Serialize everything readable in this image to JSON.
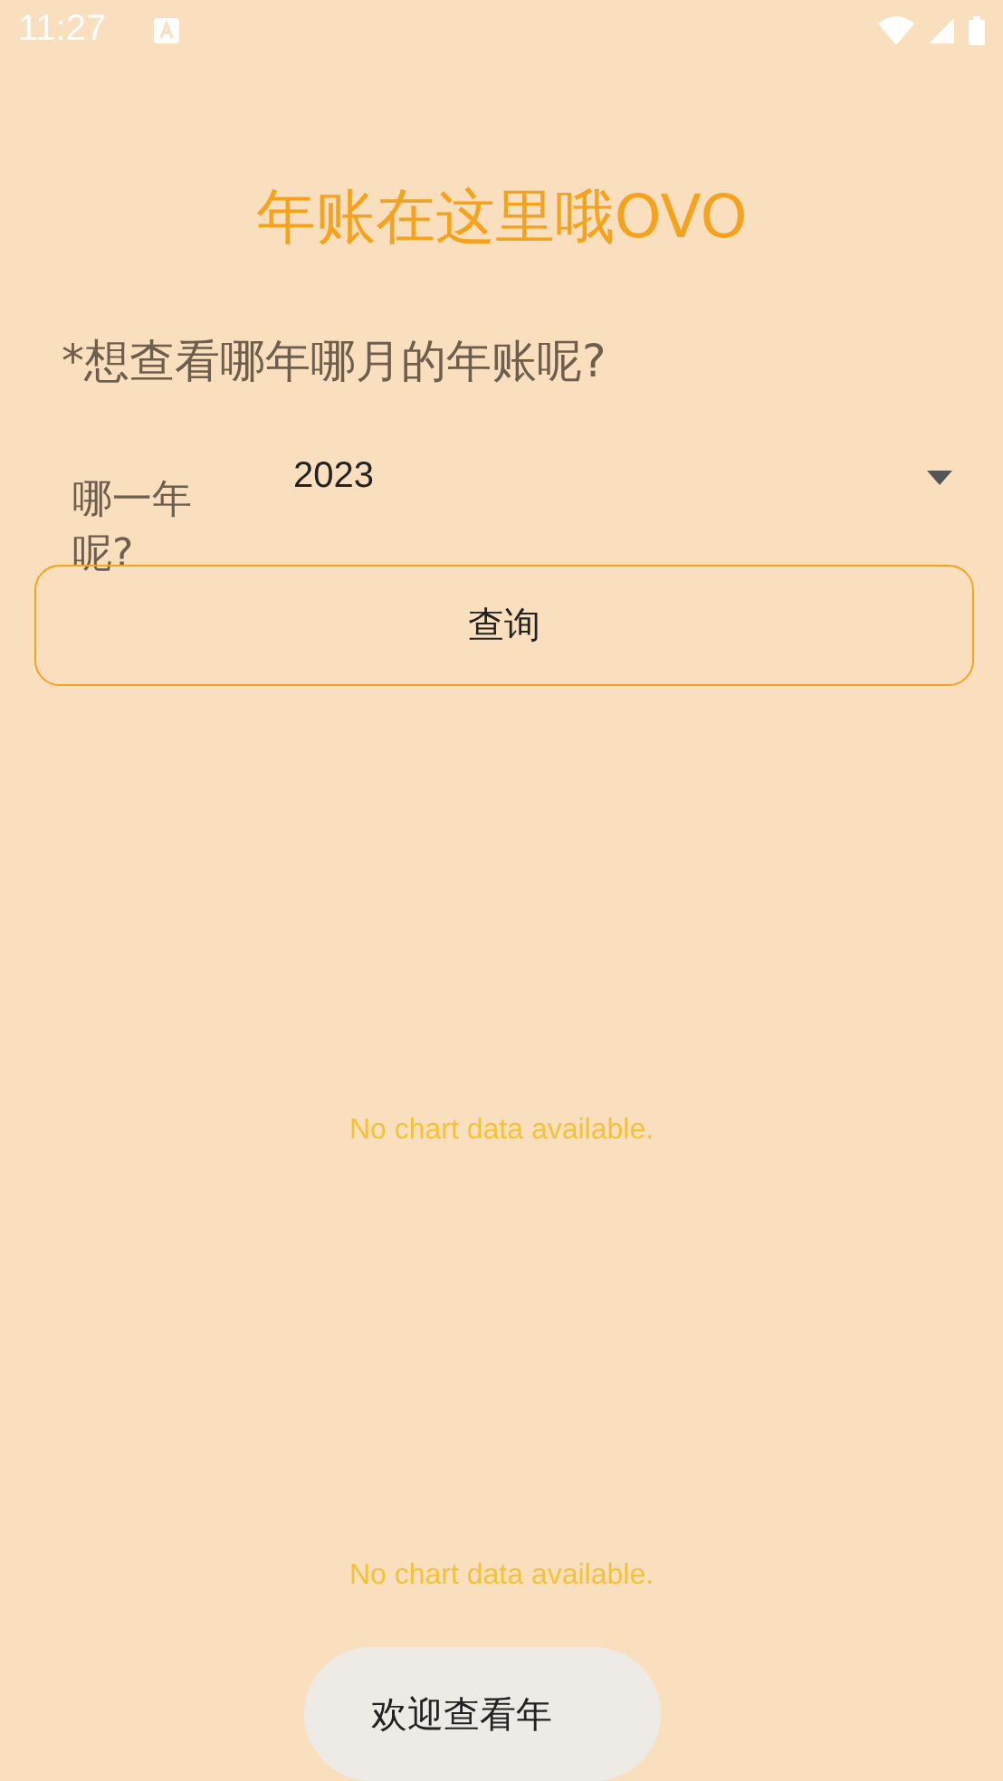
{
  "status_bar": {
    "time": "11:27"
  },
  "title": "年账在这里哦OVO",
  "question": "*想查看哪年哪月的年账呢?",
  "year_picker": {
    "label": "哪一年呢?",
    "value": "2023"
  },
  "query_button": "查询",
  "charts": [
    {
      "message": "No chart data available."
    },
    {
      "message": "No chart data available."
    }
  ],
  "toast": {
    "text": "欢迎查看年"
  }
}
